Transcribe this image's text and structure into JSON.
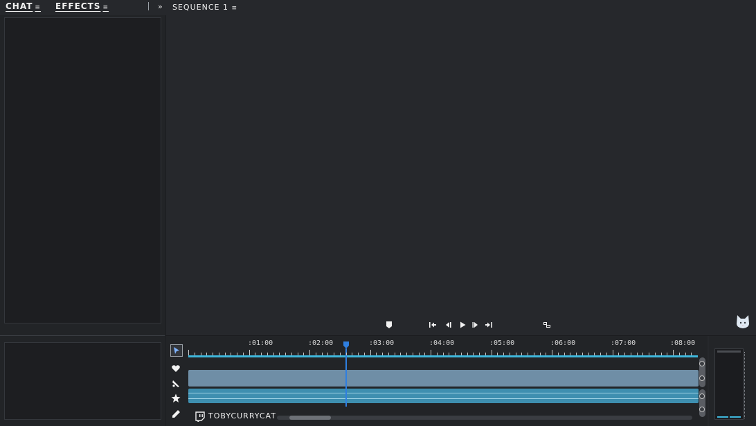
{
  "tabs": [
    {
      "label": "CHAT",
      "menu": "≡"
    },
    {
      "label": "EFFECTS",
      "menu": "≡"
    }
  ],
  "panel_toggle": "»",
  "sequence": {
    "title": "SEQUENCE 1",
    "menu": "≡"
  },
  "timeline": {
    "time_labels": [
      ":01:00",
      ":02:00",
      ":03:00",
      ":04:00",
      ":05:00",
      ":06:00",
      ":07:00",
      ":08:00"
    ],
    "playhead_time_fraction": 0.31,
    "scroll_fraction": 0.03
  },
  "channel": {
    "name": "TOBYCURRYCAT",
    "platform_icon": "twitch-icon"
  },
  "colors": {
    "accent": "#3fb7dc",
    "playhead": "#2f7fe0",
    "clip_video": "#6f8ea6",
    "clip_audio": "#3e8fb0"
  }
}
